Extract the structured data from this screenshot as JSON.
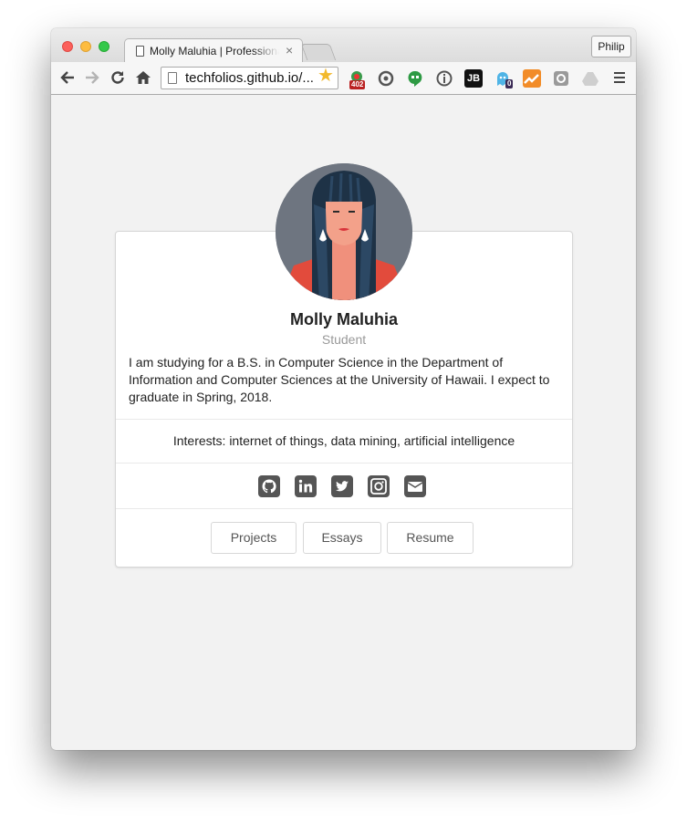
{
  "browser": {
    "tab_title": "Molly Maluhia | Professional Portfolio",
    "tab_close": "×",
    "profile_label": "Philip",
    "url": "techfolios.github.io/...",
    "extensions": [
      {
        "icon": "heart-badge-icon",
        "badge": "402"
      },
      {
        "icon": "sync-icon"
      },
      {
        "icon": "hangouts-icon"
      },
      {
        "icon": "info-circle-icon"
      },
      {
        "icon": "jetbrains-icon",
        "label": "JB"
      },
      {
        "icon": "ghost-icon",
        "badge": "0"
      },
      {
        "icon": "trend-chart-icon"
      },
      {
        "icon": "link-icon"
      },
      {
        "icon": "drive-icon"
      }
    ]
  },
  "profile": {
    "name": "Molly Maluhia",
    "role": "Student",
    "bio": "I am studying for a B.S. in Computer Science in the Department of Information and Computer Sciences at the University of Hawaii. I expect to graduate in Spring, 2018.",
    "interests": "Interests: internet of things, data mining, artificial intelligence"
  },
  "social": [
    "github-icon",
    "linkedin-icon",
    "twitter-icon",
    "instagram-icon",
    "email-icon"
  ],
  "buttons": {
    "projects": "Projects",
    "essays": "Essays",
    "resume": "Resume"
  },
  "colors": {
    "page_bg": "#f2f2f2",
    "icon_gray": "#555555",
    "avatar_bg": "#6e7580"
  }
}
